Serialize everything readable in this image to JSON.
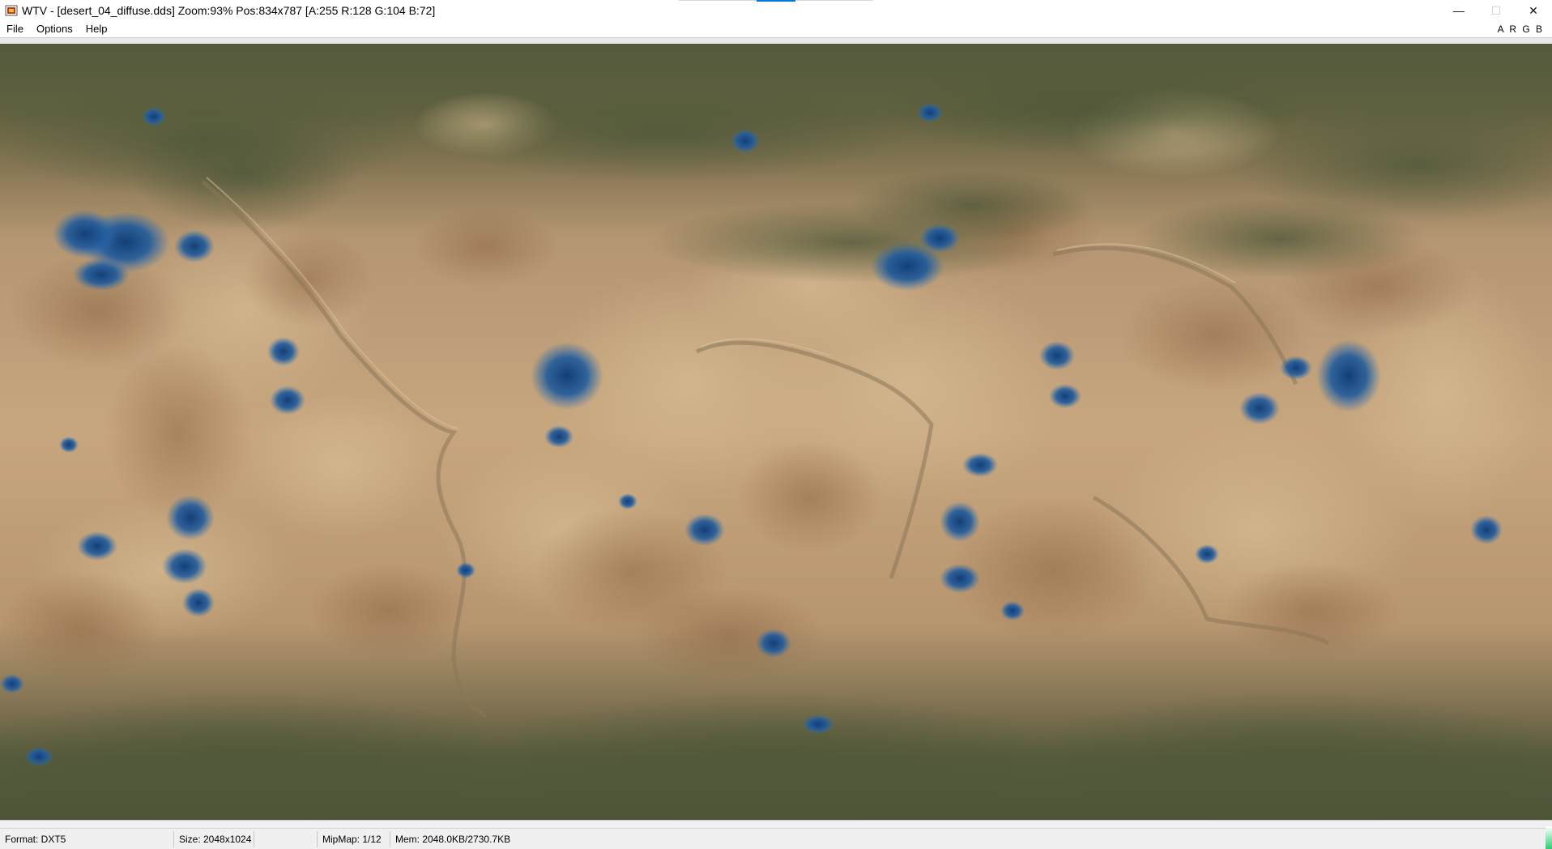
{
  "window": {
    "title": "WTV - [desert_04_diffuse.dds] Zoom:93% Pos:834x787 [A:255 R:128 G:104 B:72]",
    "minimize_glyph": "—",
    "maximize_glyph": "☐",
    "close_glyph": "✕",
    "app_icon": "wtv-app-icon"
  },
  "menu": {
    "items": [
      "File",
      "Options",
      "Help"
    ],
    "channels": "A R G B"
  },
  "image": {
    "file": "desert_04_diffuse.dds",
    "colors": {
      "desert": "#c2a07a",
      "dark_band": "#5a5a3e",
      "water": "#1d4f8c",
      "rock": "#9a8166"
    }
  },
  "status": {
    "format": "Format: DXT5",
    "size": "Size: 2048x1024",
    "empty": "",
    "mipmap": "MipMap: 1/12",
    "mem": "Mem: 2048.0KB/2730.7KB"
  }
}
